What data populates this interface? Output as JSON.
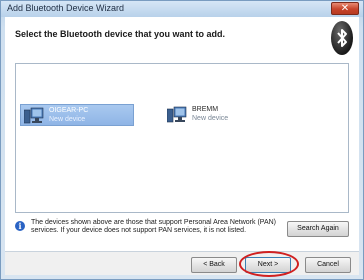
{
  "window": {
    "title": "Add Bluetooth Device Wizard",
    "close_glyph": "✕"
  },
  "header": {
    "heading": "Select the Bluetooth device that you want to add.",
    "logo_icon": "bluetooth-icon"
  },
  "devices": [
    {
      "name": "OIGEAR-PC",
      "status": "New device",
      "icon": "computer-icon",
      "selected": true
    },
    {
      "name": "BREMM",
      "status": "New device",
      "icon": "computer-icon",
      "selected": false
    }
  ],
  "info": {
    "icon": "info-icon",
    "text": "The devices shown above are those that support Personal Area Network (PAN) services. If your device does not support PAN services, it is not listed."
  },
  "buttons": {
    "search_again": "Search Again",
    "back": "< Back",
    "next": "Next >",
    "cancel": "Cancel"
  },
  "colors": {
    "selection": "#8fb5e6",
    "highlight_ring": "#d02020"
  }
}
